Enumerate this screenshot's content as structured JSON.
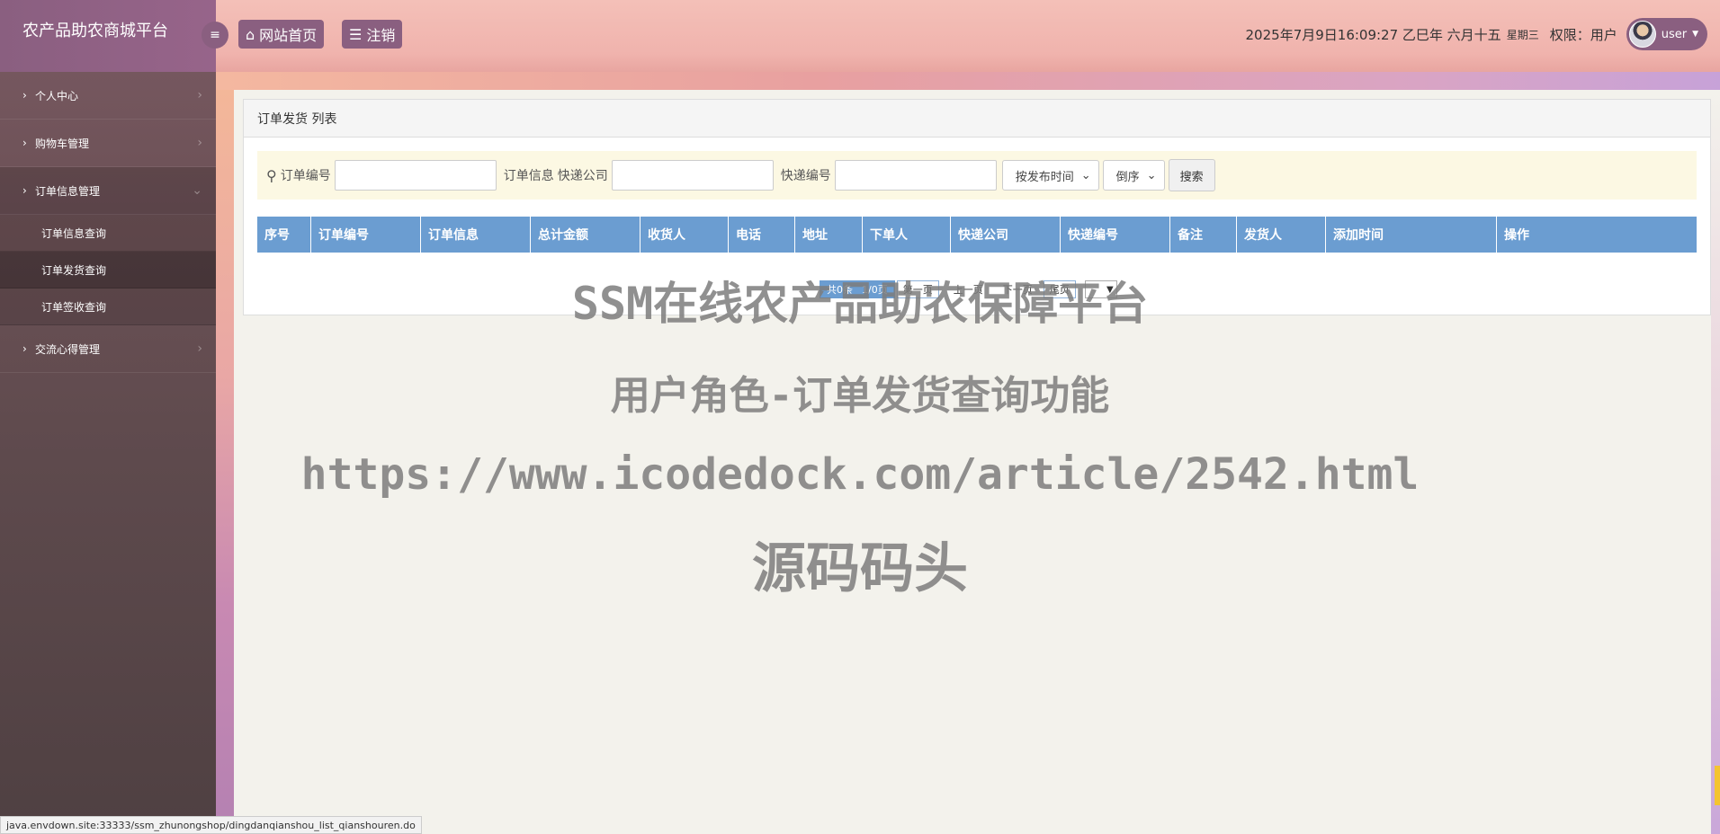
{
  "app": {
    "title": "农产品助农商城平台"
  },
  "sidebar": {
    "items": [
      {
        "label": "个人中心"
      },
      {
        "label": "购物车管理"
      },
      {
        "label": "订单信息管理",
        "children": [
          {
            "label": "订单信息查询"
          },
          {
            "label": "订单发货查询"
          },
          {
            "label": "订单签收查询"
          }
        ]
      },
      {
        "label": "交流心得管理"
      }
    ]
  },
  "header": {
    "home_label": "网站首页",
    "logout_label": "注销",
    "datetime": "2025年7月9日16:09:27 乙巳年 六月十五",
    "weekday": "星期三",
    "role": "权限：用户",
    "username": "user"
  },
  "panel": {
    "title": "订单发货 列表",
    "search": {
      "order_no_label": "订单编号",
      "order_info_label": "订单信息",
      "express_company_label": "快递公司",
      "express_no_label": "快递编号",
      "sort_field": "按发布时间",
      "sort_order": "倒序",
      "search_button": "搜索"
    },
    "columns": [
      "序号",
      "订单编号",
      "订单信息",
      "总计金额",
      "收货人",
      "电话",
      "地址",
      "下单人",
      "快递公司",
      "快递编号",
      "备注",
      "发货人",
      "添加时间",
      "操作"
    ],
    "pager": {
      "info": "共0条",
      "pages": "1/0页",
      "first": "第一页",
      "prev": "上一页",
      "next": "下一页",
      "last": "尾页"
    }
  },
  "watermark": {
    "line1": "SSM在线农产品助农保障平台",
    "line2": "用户角色-订单发货查询功能",
    "line3": "https://www.icodedock.com/article/2542.html",
    "line4": "源码码头"
  },
  "statusbar": {
    "url": "java.envdown.site:33333/ssm_zhunongshop/dingdanqianshou_list_qianshouren.do"
  }
}
